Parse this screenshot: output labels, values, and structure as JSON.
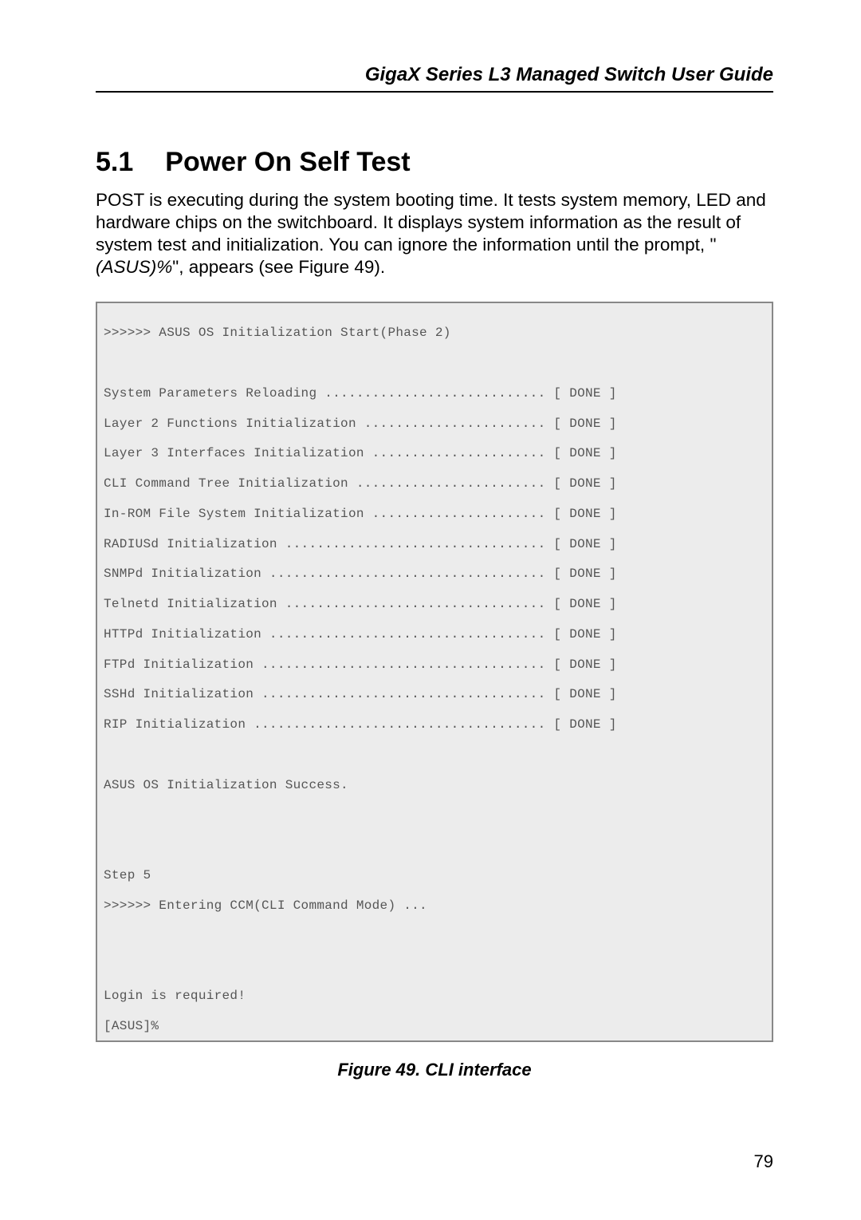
{
  "header": {
    "title": "GigaX Series L3 Managed Switch User Guide"
  },
  "section": {
    "number": "5.1",
    "title": "Power On Self Test"
  },
  "body": {
    "p1_a": "POST is executing during the system booting time. It tests system memory, LED and hardware chips on the switchboard. It displays system information as the result of system test and initialization. You can ignore the information until the prompt, \"",
    "p1_italic": "(ASUS)%",
    "p1_b": "\", appears (see Figure 49)."
  },
  "terminal": {
    "start_line": ">>>>>> ASUS OS Initialization Start(Phase 2)",
    "rows": [
      {
        "label": "System Parameters Reloading ............................",
        "status": "[ DONE ]"
      },
      {
        "label": "Layer 2 Functions Initialization .......................",
        "status": "[ DONE ]"
      },
      {
        "label": "Layer 3 Interfaces Initialization ......................",
        "status": "[ DONE ]"
      },
      {
        "label": "CLI Command Tree Initialization ........................",
        "status": "[ DONE ]"
      },
      {
        "label": "In-ROM File System Initialization ......................",
        "status": "[ DONE ]"
      },
      {
        "label": "RADIUSd Initialization .................................",
        "status": "[ DONE ]"
      },
      {
        "label": "SNMPd Initialization ...................................",
        "status": "[ DONE ]"
      },
      {
        "label": "Telnetd Initialization .................................",
        "status": "[ DONE ]"
      },
      {
        "label": "HTTPd Initialization ...................................",
        "status": "[ DONE ]"
      },
      {
        "label": "FTPd Initialization ....................................",
        "status": "[ DONE ]"
      },
      {
        "label": "SSHd Initialization ....................................",
        "status": "[ DONE ]"
      },
      {
        "label": "RIP Initialization .....................................",
        "status": "[ DONE ]"
      }
    ],
    "success_line": "ASUS OS Initialization Success.",
    "step_line": "Step 5",
    "ccm_line": ">>>>>> Entering CCM(CLI Command Mode) ...",
    "login_line": "Login is required!",
    "prompt_line": "[ASUS]%"
  },
  "figure": {
    "caption": "Figure 49.  CLI interface"
  },
  "page_number": "79"
}
